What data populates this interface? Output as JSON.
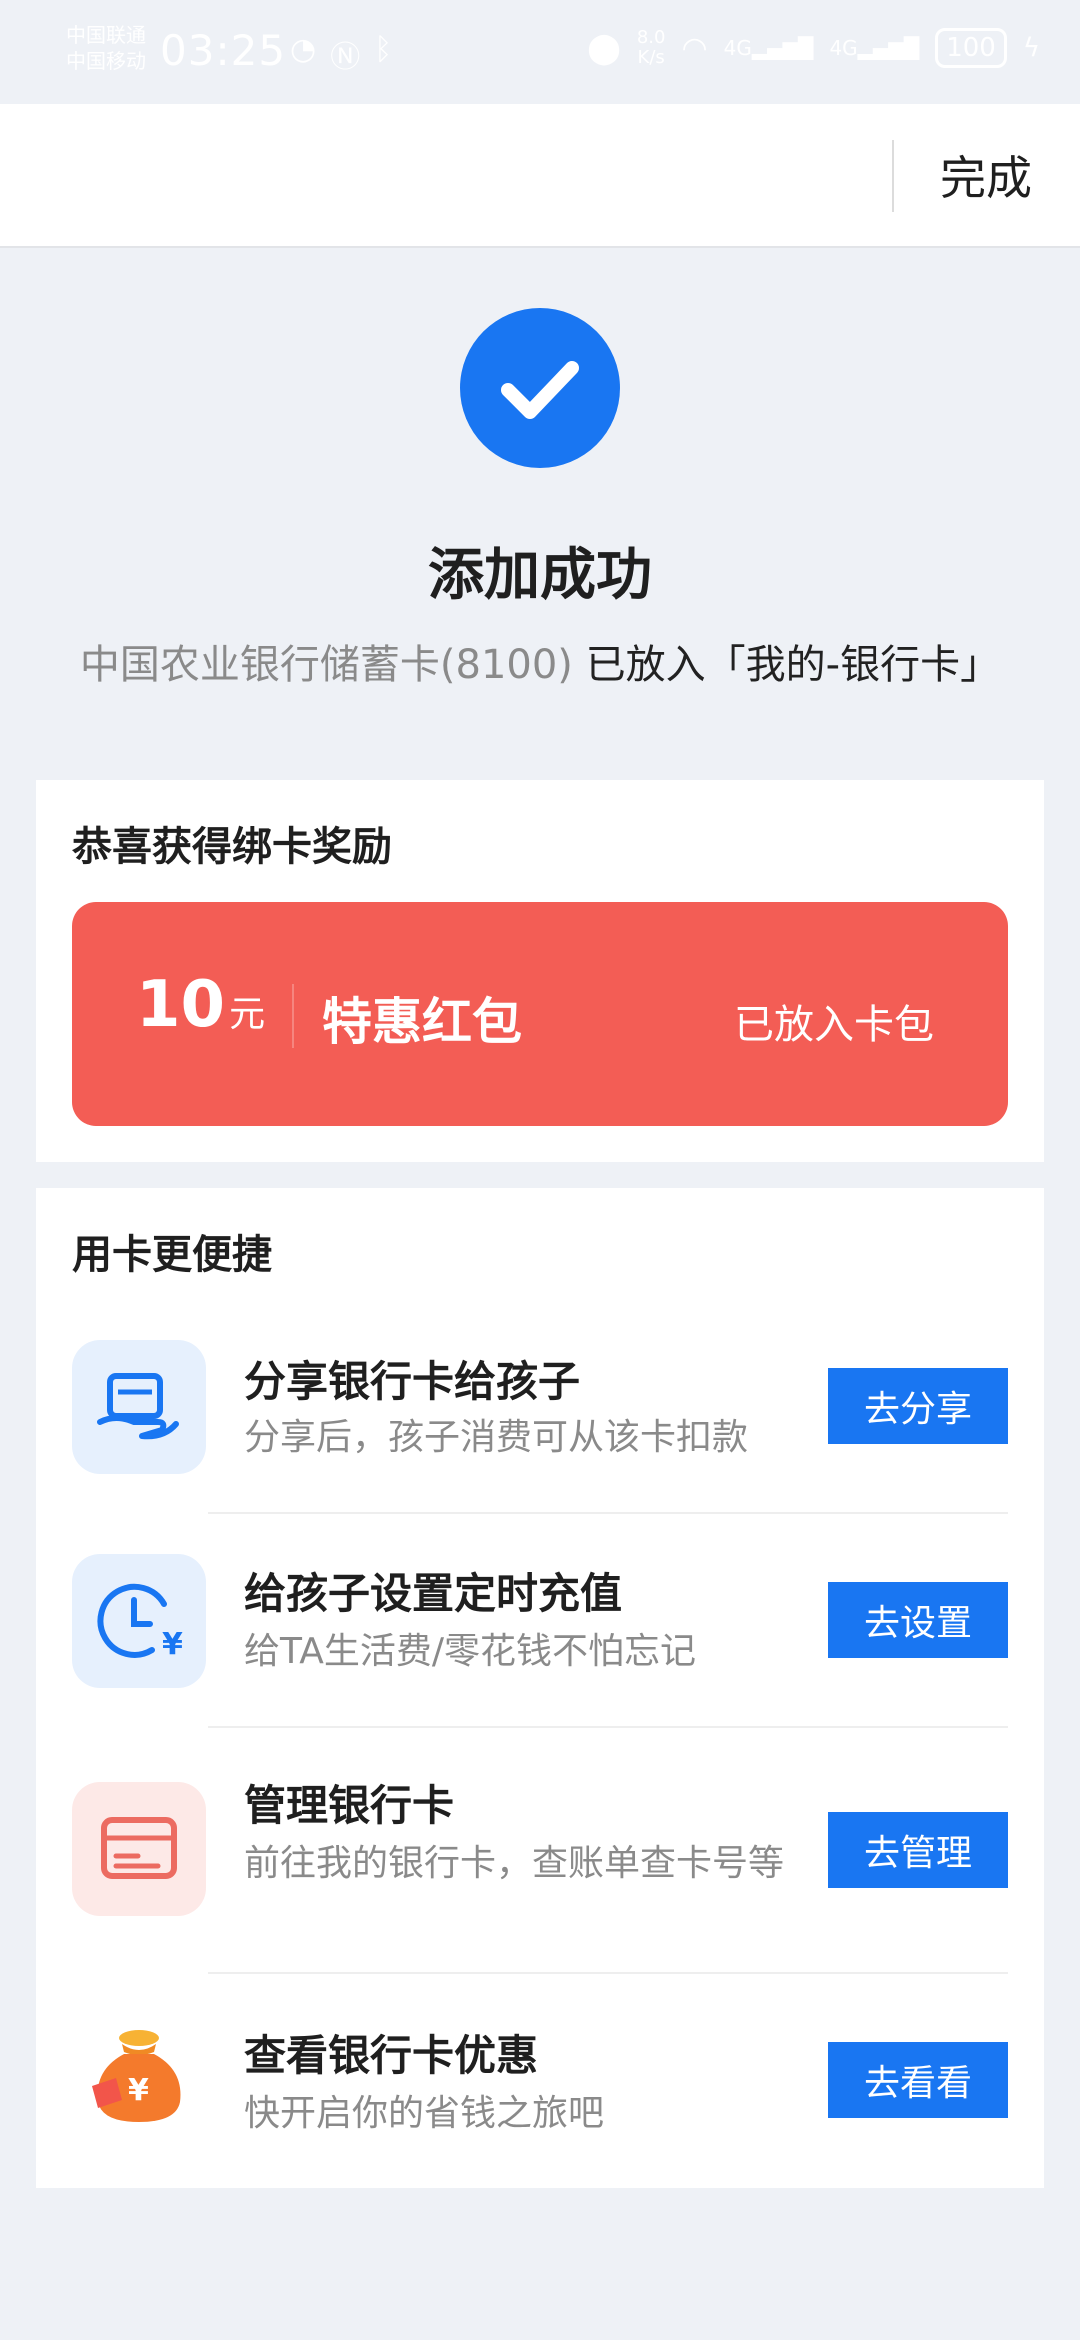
{
  "status_bar": {
    "carrier1": "中国联通",
    "carrier2": "中国移动",
    "time": "03:25",
    "speed_value": "8.0",
    "speed_unit": "K/s",
    "net1": "4G",
    "net2": "4G",
    "battery": "100"
  },
  "header": {
    "done_label": "完成"
  },
  "success": {
    "title": "添加成功",
    "card_name": "中国农业银行储蓄卡(8100)",
    "placed_text": "已放入「我的-银行卡」"
  },
  "reward": {
    "heading": "恭喜获得绑卡奖励",
    "amount": "10",
    "unit": "元",
    "name": "特惠红包",
    "status": "已放入卡包"
  },
  "features": {
    "heading": "用卡更便捷",
    "items": [
      {
        "title": "分享银行卡给孩子",
        "subtitle": "分享后，孩子消费可从该卡扣款",
        "button": "去分享",
        "icon": "share-card-icon"
      },
      {
        "title": "给孩子设置定时充值",
        "subtitle": "给TA生活费/零花钱不怕忘记",
        "button": "去设置",
        "icon": "clock-yuan-icon"
      },
      {
        "title": "管理银行卡",
        "subtitle": "前往我的银行卡，查账单查卡号等",
        "button": "去管理",
        "icon": "bank-card-icon"
      },
      {
        "title": "查看银行卡优惠",
        "subtitle": "快开启你的省钱之旅吧",
        "button": "去看看",
        "icon": "money-bag-icon"
      }
    ]
  },
  "colors": {
    "accent": "#1976f2",
    "red_packet": "#f35d55",
    "background": "#eef1f6"
  }
}
